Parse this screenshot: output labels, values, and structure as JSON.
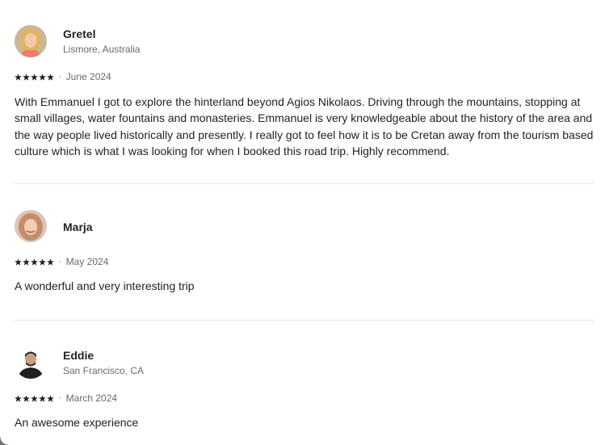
{
  "reviews": [
    {
      "name": "Gretel",
      "location": "Lismore, Australia",
      "rating": 5,
      "date": "June 2024",
      "text": "With Emmanuel I got to explore the hinterland beyond Agios Nikolaos. Driving through the mountains, stopping at small villages, water fountains and monasteries. Emmanuel is very knowledgeable about the history of the area and the way people lived historically and presently. I really got to feel how it is to be Cretan away from the tourism based culture which is what I was looking for when I booked this road trip. Highly recommend."
    },
    {
      "name": "Marja",
      "location": "",
      "rating": 5,
      "date": "May 2024",
      "text": "A wonderful and very interesting trip"
    },
    {
      "name": "Eddie",
      "location": "San Francisco, CA",
      "rating": 5,
      "date": "March 2024",
      "text": "An awesome experience"
    }
  ],
  "separator": "·",
  "colors": {
    "text": "#222222",
    "muted": "#6a6a6a",
    "divider": "#e5e5e5",
    "star": "#222222"
  },
  "icons": {
    "star": "star-icon"
  }
}
